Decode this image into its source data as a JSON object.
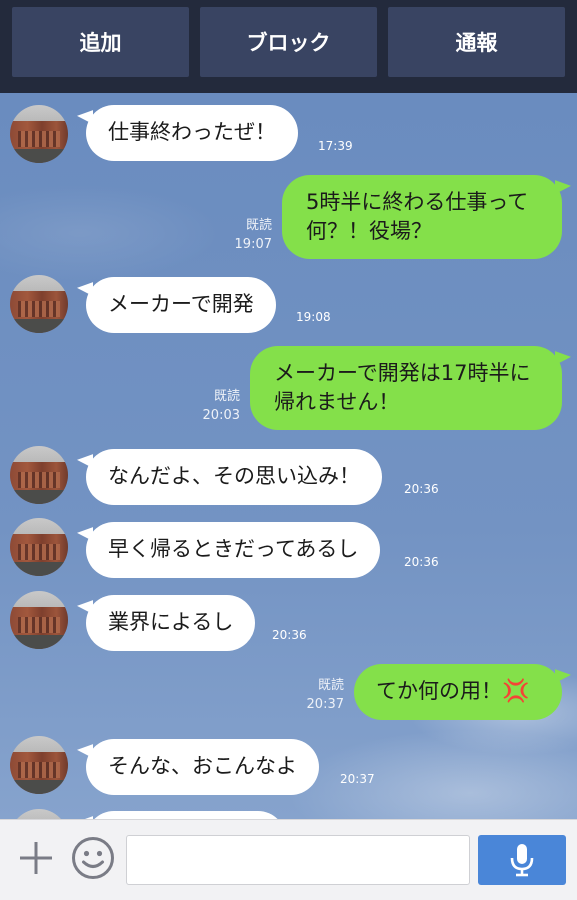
{
  "top_actions": {
    "add_label": "追加",
    "block_label": "ブロック",
    "report_label": "通報"
  },
  "messages": [
    {
      "side": "in",
      "text": "仕事終わったぜ！",
      "time": "17:39"
    },
    {
      "side": "out",
      "text": "5時半に終わる仕事って何？！役場？",
      "read": "既読",
      "time": "19:07"
    },
    {
      "side": "in",
      "text": "メーカーで開発",
      "time": "19:08"
    },
    {
      "side": "out",
      "text": "メーカーで開発は17時半に帰れません！",
      "read": "既読",
      "time": "20:03"
    },
    {
      "side": "in",
      "text": "なんだよ、その思い込み！",
      "time": "20:36"
    },
    {
      "side": "in",
      "text": "早く帰るときだってあるし",
      "time": "20:36"
    },
    {
      "side": "in",
      "text": "業界によるし",
      "time": "20:36"
    },
    {
      "side": "out",
      "text": "てか何の用！",
      "emoji": "💢",
      "read": "既読",
      "time": "20:37"
    },
    {
      "side": "in",
      "text": "そんな、おこんなよ",
      "time": "20:37"
    }
  ],
  "input": {
    "placeholder": ""
  },
  "icons": {
    "add": "plus-icon",
    "emoji": "smiley-icon",
    "voice": "microphone-icon"
  },
  "colors": {
    "outgoing_bubble": "#84e04a",
    "incoming_bubble": "#ffffff",
    "top_bar": "#232a3c",
    "mic_button": "#4a86d8"
  }
}
